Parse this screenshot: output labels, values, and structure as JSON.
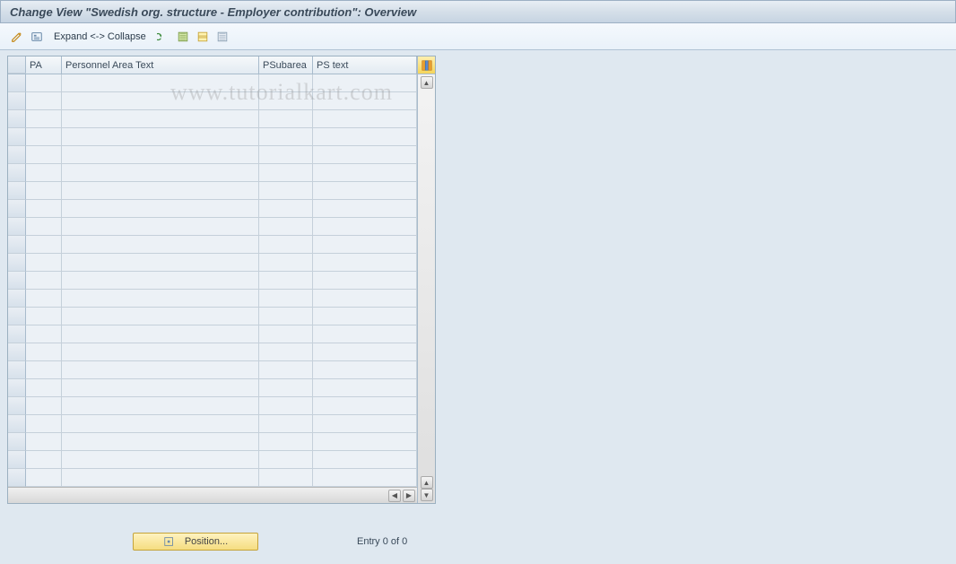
{
  "title": "Change View \"Swedish org. structure - Employer contribution\": Overview",
  "toolbar": {
    "expand_collapse": "Expand <-> Collapse"
  },
  "table": {
    "headers": {
      "pa": "PA",
      "pat": "Personnel Area Text",
      "psub": "PSubarea",
      "pst": "PS text"
    },
    "rows": [
      {},
      {},
      {},
      {},
      {},
      {},
      {},
      {},
      {},
      {},
      {},
      {},
      {},
      {},
      {},
      {},
      {},
      {},
      {},
      {},
      {},
      {},
      {}
    ]
  },
  "footer": {
    "position_btn": "Position...",
    "entry": "Entry 0 of 0"
  },
  "watermark": "www.tutorialkart.com"
}
